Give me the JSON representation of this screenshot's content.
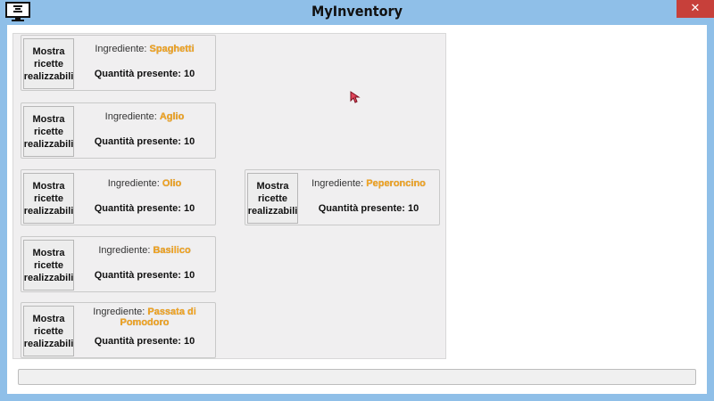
{
  "window": {
    "title": "MyInventory",
    "close_label": "✕"
  },
  "cards": [
    {
      "button_label": "Mostra ricette realizzabili",
      "ingredient_label": "Ingrediente: ",
      "ingredient_value": "Spaghetti",
      "quantity_text": "Quantità presente: 10"
    },
    {
      "button_label": "Mostra ricette realizzabili",
      "ingredient_label": "Ingrediente: ",
      "ingredient_value": "Aglio",
      "quantity_text": "Quantità presente: 10"
    },
    {
      "button_label": "Mostra ricette realizzabili",
      "ingredient_label": "Ingrediente: ",
      "ingredient_value": "Olio",
      "quantity_text": "Quantità presente: 10"
    },
    {
      "button_label": "Mostra ricette realizzabili",
      "ingredient_label": "Ingrediente: ",
      "ingredient_value": "Basilico",
      "quantity_text": "Quantità presente: 10"
    },
    {
      "button_label": "Mostra ricette realizzabili",
      "ingredient_label": "Ingrediente: ",
      "ingredient_value": "Passata di Pomodoro",
      "quantity_text": "Quantità presente: 10"
    },
    {
      "button_label": "Mostra ricette realizzabili",
      "ingredient_label": "Ingrediente: ",
      "ingredient_value": "Peperoncino",
      "quantity_text": "Quantità presente: 10"
    }
  ],
  "colors": {
    "title_bar": "#8fbfe8",
    "close_button": "#c7403a",
    "ingredient_value": "#f5a623"
  },
  "icons": {
    "app": "monitor-icon",
    "close": "close-icon",
    "cursor": "mouse-cursor-icon"
  }
}
